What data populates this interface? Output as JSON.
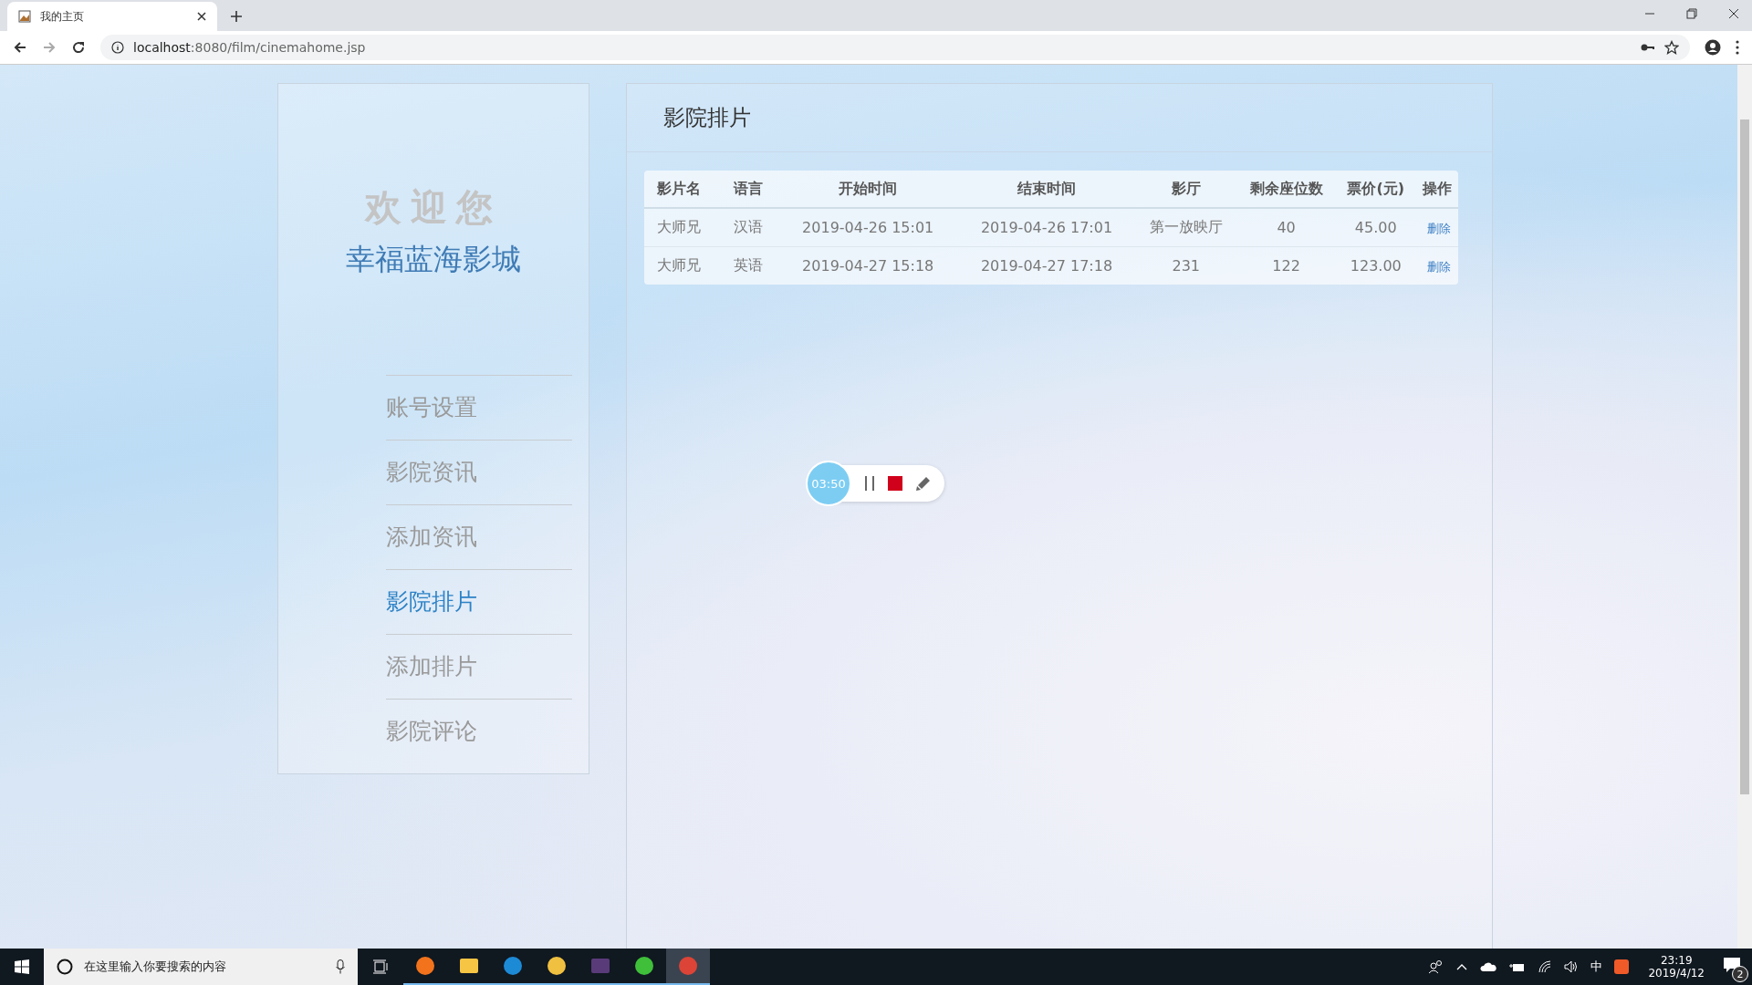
{
  "browser": {
    "tab_title": "我的主页",
    "url_host": "localhost",
    "url_rest": ":8080/film/cinemahome.jsp"
  },
  "sidebar": {
    "welcome": "欢迎您",
    "cinema_name": "幸福蓝海影城",
    "items": [
      {
        "label": "账号设置",
        "selected": false
      },
      {
        "label": "影院资讯",
        "selected": false
      },
      {
        "label": "添加资讯",
        "selected": false
      },
      {
        "label": "影院排片",
        "selected": true
      },
      {
        "label": "添加排片",
        "selected": false
      },
      {
        "label": "影院评论",
        "selected": false
      }
    ]
  },
  "panel": {
    "title": "影院排片",
    "table": {
      "columns": [
        "影片名",
        "语言",
        "开始时间",
        "结束时间",
        "影厅",
        "剩余座位数",
        "票价(元)",
        "操作"
      ],
      "rows": [
        {
          "cells": [
            "大师兄",
            "汉语",
            "2019-04-26 15:01",
            "2019-04-26 17:01",
            "第一放映厅",
            "40",
            "45.00"
          ],
          "action": "删除"
        },
        {
          "cells": [
            "大师兄",
            "英语",
            "2019-04-27 15:18",
            "2019-04-27 17:18",
            "231",
            "122",
            "123.00"
          ],
          "action": "删除"
        }
      ]
    }
  },
  "recorder": {
    "time": "03:50"
  },
  "taskbar": {
    "search_placeholder": "在这里输入你要搜索的内容",
    "apps": [
      {
        "kind": "firefox",
        "selected": false
      },
      {
        "kind": "folder",
        "selected": false
      },
      {
        "kind": "contacts",
        "selected": false
      },
      {
        "kind": "paw",
        "selected": false
      },
      {
        "kind": "ide",
        "selected": false
      },
      {
        "kind": "chat",
        "selected": false
      },
      {
        "kind": "chrome",
        "selected": true
      }
    ],
    "ime": "中",
    "time": "23:19",
    "date": "2019/4/12",
    "notifications": "2"
  }
}
